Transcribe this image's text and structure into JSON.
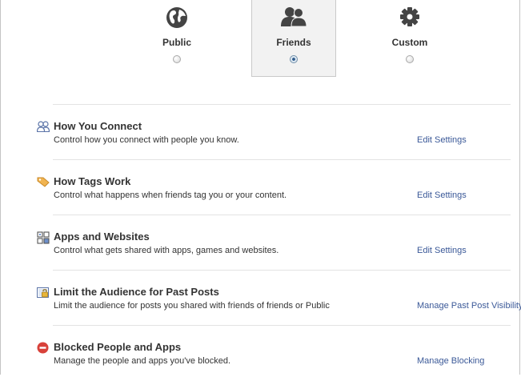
{
  "audience": {
    "options": [
      {
        "label": "Public",
        "icon": "globe-icon",
        "selected": false
      },
      {
        "label": "Friends",
        "icon": "friends-icon",
        "selected": true
      },
      {
        "label": "Custom",
        "icon": "gear-icon",
        "selected": false
      }
    ]
  },
  "sections": [
    {
      "title": "How You Connect",
      "description": "Control how you connect with people you know.",
      "link": "Edit Settings",
      "icon": "people-icon"
    },
    {
      "title": "How Tags Work",
      "description": "Control what happens when friends tag you or your content.",
      "link": "Edit Settings",
      "icon": "tag-icon"
    },
    {
      "title": "Apps and Websites",
      "description": "Control what gets shared with apps, games and websites.",
      "link": "Edit Settings",
      "icon": "apps-icon"
    },
    {
      "title": "Limit the Audience for Past Posts",
      "description": "Limit the audience for posts you shared with friends of friends or Public",
      "link": "Manage Past Post Visibility",
      "icon": "lock-icon"
    },
    {
      "title": "Blocked People and Apps",
      "description": "Manage the people and apps you've blocked.",
      "link": "Manage Blocking",
      "icon": "blocked-icon"
    }
  ],
  "colors": {
    "link": "#3b5998",
    "text": "#333333",
    "blocked_red": "#d8413a",
    "tag_orange": "#e8a33d",
    "icon_dark": "#444444"
  }
}
